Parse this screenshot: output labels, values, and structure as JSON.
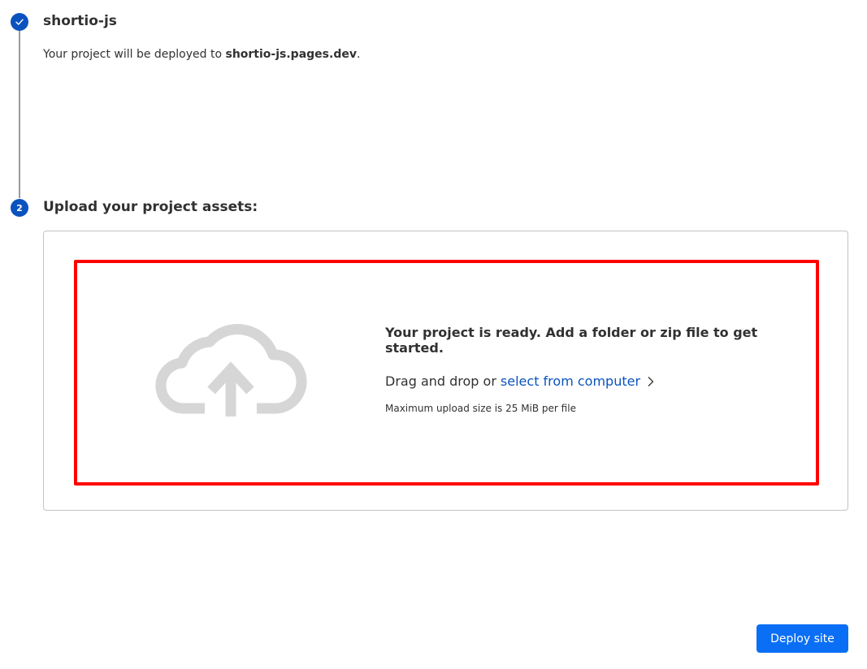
{
  "step1": {
    "title": "shortio-js",
    "note_prefix": "Your project will be deployed to ",
    "note_domain": "shortio-js.pages.dev",
    "note_suffix": "."
  },
  "step2": {
    "number": "2",
    "title": "Upload your project assets:"
  },
  "dropzone": {
    "icon": "cloud-upload-icon",
    "heading": "Your project is ready. Add a folder or zip file to get started.",
    "drag_text": "Drag and drop or",
    "select_link": "select from computer",
    "size_note": "Maximum upload size is 25 MiB per file"
  },
  "footer": {
    "deploy_label": "Deploy site"
  },
  "colors": {
    "accent": "#0a53be",
    "button": "#0b6ff5",
    "highlight": "#ff0000",
    "icon_gray": "#d6d6d6"
  }
}
